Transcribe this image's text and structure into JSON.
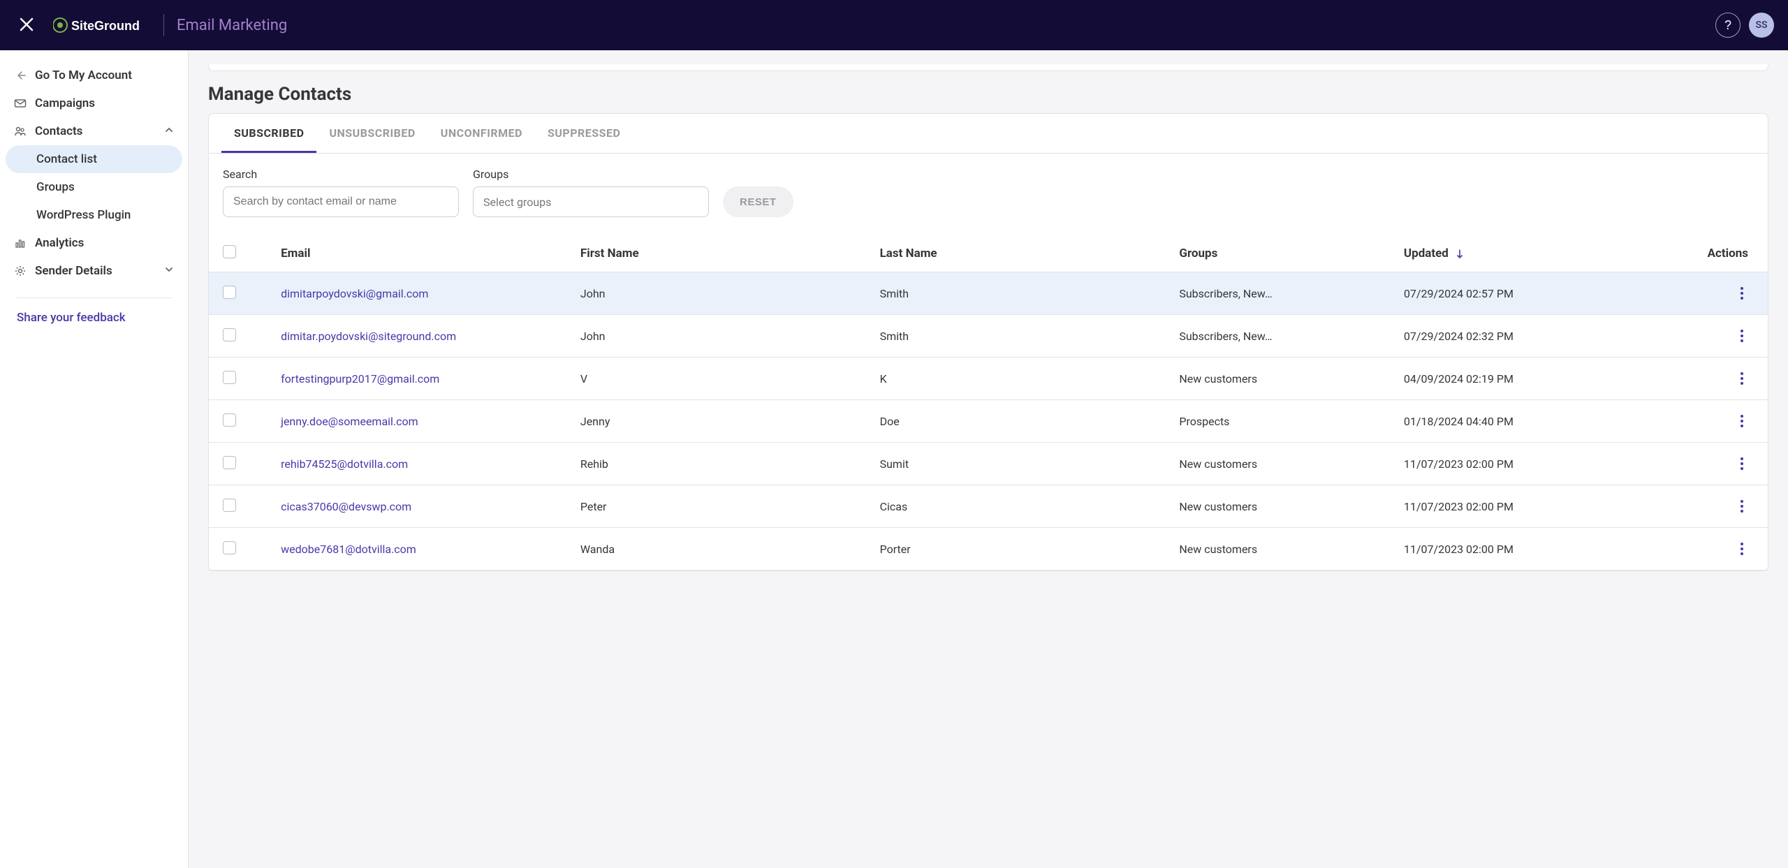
{
  "header": {
    "app_title": "Email Marketing",
    "avatar_initials": "SS"
  },
  "sidebar": {
    "go_back": "Go To My Account",
    "items": {
      "campaigns": "Campaigns",
      "contacts": "Contacts",
      "analytics": "Analytics",
      "sender_details": "Sender Details"
    },
    "contacts_sub": {
      "contact_list": "Contact list",
      "groups": "Groups",
      "wp_plugin": "WordPress Plugin"
    },
    "feedback": "Share your feedback"
  },
  "main": {
    "title": "Manage Contacts",
    "tabs": {
      "subscribed": "SUBSCRIBED",
      "unsubscribed": "UNSUBSCRIBED",
      "unconfirmed": "UNCONFIRMED",
      "suppressed": "SUPPRESSED"
    },
    "filters": {
      "search_label": "Search",
      "search_placeholder": "Search by contact email or name",
      "groups_label": "Groups",
      "groups_placeholder": "Select groups",
      "reset": "RESET"
    },
    "columns": {
      "email": "Email",
      "first_name": "First Name",
      "last_name": "Last Name",
      "groups": "Groups",
      "updated": "Updated",
      "actions": "Actions"
    },
    "rows": [
      {
        "email": "dimitarpoydovski@gmail.com",
        "first_name": "John",
        "last_name": "Smith",
        "groups": "Subscribers, New…",
        "updated": "07/29/2024 02:57 PM"
      },
      {
        "email": "dimitar.poydovski@siteground.com",
        "first_name": "John",
        "last_name": "Smith",
        "groups": "Subscribers, New…",
        "updated": "07/29/2024 02:32 PM"
      },
      {
        "email": "fortestingpurp2017@gmail.com",
        "first_name": "V",
        "last_name": "K",
        "groups": "New customers",
        "updated": "04/09/2024 02:19 PM"
      },
      {
        "email": "jenny.doe@someemail.com",
        "first_name": "Jenny",
        "last_name": "Doe",
        "groups": "Prospects",
        "updated": "01/18/2024 04:40 PM"
      },
      {
        "email": "rehib74525@dotvilla.com",
        "first_name": "Rehib",
        "last_name": "Sumit",
        "groups": "New customers",
        "updated": "11/07/2023 02:00 PM"
      },
      {
        "email": "cicas37060@devswp.com",
        "first_name": "Peter",
        "last_name": "Cicas",
        "groups": "New customers",
        "updated": "11/07/2023 02:00 PM"
      },
      {
        "email": "wedobe7681@dotvilla.com",
        "first_name": "Wanda",
        "last_name": "Porter",
        "groups": "New customers",
        "updated": "11/07/2023 02:00 PM"
      }
    ]
  }
}
